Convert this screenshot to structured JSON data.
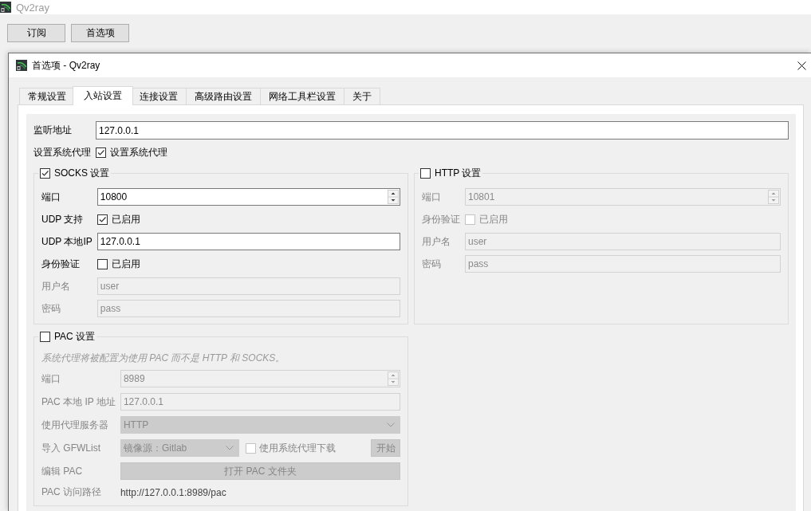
{
  "main_window": {
    "title": "Qv2ray",
    "buttons": [
      "订阅",
      "首选项"
    ]
  },
  "dialog": {
    "title": "首选项 - Qv2ray",
    "tabs": [
      {
        "label": "常规设置",
        "selected": false
      },
      {
        "label": "入站设置",
        "selected": true
      },
      {
        "label": "连接设置",
        "selected": false
      },
      {
        "label": "高级路由设置",
        "selected": false
      },
      {
        "label": "网络工具栏设置",
        "selected": false
      },
      {
        "label": "关于",
        "selected": false
      }
    ],
    "listen_address": {
      "label": "监听地址",
      "value": "127.0.0.1"
    },
    "system_proxy": {
      "label": "设置系统代理",
      "option": "设置系统代理",
      "checked": true
    },
    "groups": [
      {
        "title": "SOCKS 设置",
        "checked": true,
        "rows": [
          {
            "kind": "spin",
            "label": "端口",
            "value": "10800",
            "disabled": false
          },
          {
            "kind": "check",
            "label": "UDP 支持",
            "option": "已启用",
            "checked": true,
            "disabled": false
          },
          {
            "kind": "text",
            "label": "UDP 本地IP",
            "value": "127.0.0.1",
            "disabled": false
          },
          {
            "kind": "check",
            "label": "身份验证",
            "option": "已启用",
            "checked": false,
            "disabled": false
          },
          {
            "kind": "text",
            "label": "用户名",
            "value": "user",
            "disabled": true
          },
          {
            "kind": "text",
            "label": "密码",
            "value": "pass",
            "disabled": true
          }
        ]
      },
      {
        "title": "HTTP 设置",
        "checked": false,
        "rows": [
          {
            "kind": "spin",
            "label": "端口",
            "value": "10801",
            "disabled": true
          },
          {
            "kind": "check",
            "label": "身份验证",
            "option": "已启用",
            "checked": false,
            "disabled": true
          },
          {
            "kind": "text",
            "label": "用户名",
            "value": "user",
            "disabled": true
          },
          {
            "kind": "text",
            "label": "密码",
            "value": "pass",
            "disabled": true
          }
        ]
      },
      {
        "title": "PAC 设置",
        "checked": false,
        "rows": [
          {
            "kind": "note",
            "text": "系统代理将被配置为使用 PAC 而不是 HTTP 和 SOCKS。",
            "disabled": true
          },
          {
            "kind": "spin",
            "label": "端口",
            "value": "8989",
            "disabled": true
          },
          {
            "kind": "text",
            "label": "PAC 本地 IP 地址",
            "value": "127.0.0.1",
            "disabled": true
          },
          {
            "kind": "combo",
            "label": "使用代理服务器",
            "value": "HTTP",
            "disabled": true
          },
          {
            "kind": "import",
            "label": "导入 GFWList",
            "value": "镜像源：Gitlab",
            "option": "使用系统代理下载",
            "checked": false,
            "button": "开始",
            "disabled": true
          },
          {
            "kind": "button",
            "label": "编辑 PAC",
            "button": "打开 PAC 文件夹",
            "disabled": true
          },
          {
            "kind": "info",
            "label": "PAC 访问路径",
            "value": "http://127.0.0.1:8989/pac",
            "disabled": true
          }
        ]
      }
    ]
  }
}
